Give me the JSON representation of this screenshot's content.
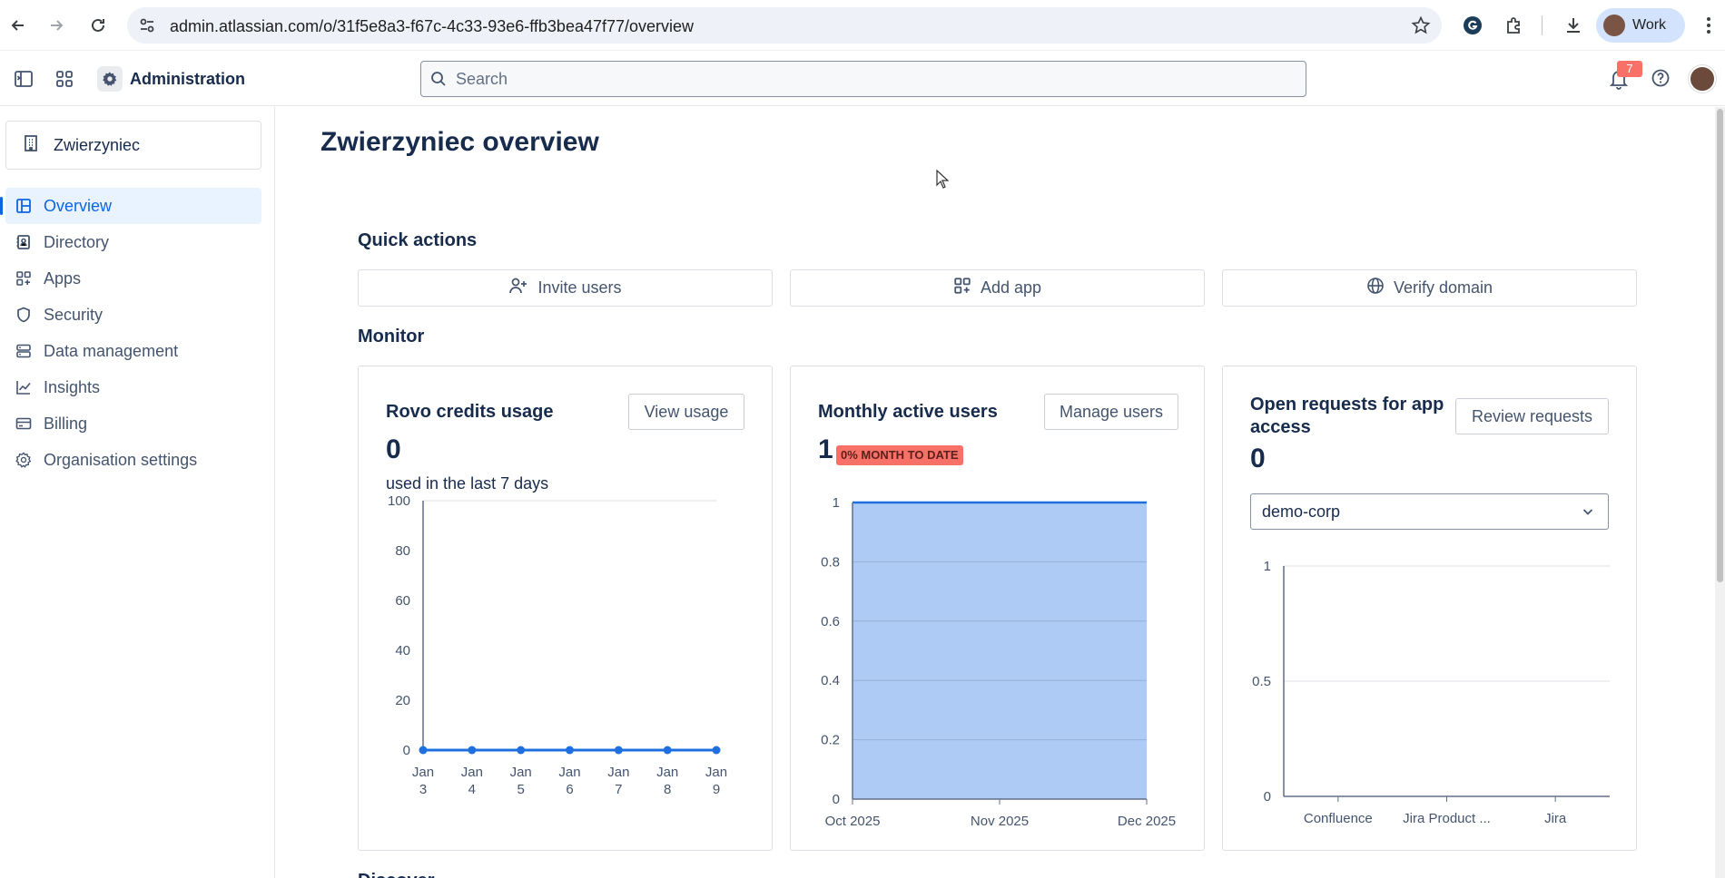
{
  "browser": {
    "url": "admin.atlassian.com/o/31f5e8a3-f67c-4c33-93e6-ffb3bea47f77/overview",
    "profile_label": "Work"
  },
  "header": {
    "title": "Administration",
    "search_placeholder": "Search",
    "notifications_count": "7"
  },
  "sidebar": {
    "org_name": "Zwierzyniec",
    "items": [
      {
        "label": "Overview",
        "icon": "overview-icon",
        "active": true
      },
      {
        "label": "Directory",
        "icon": "directory-icon",
        "active": false
      },
      {
        "label": "Apps",
        "icon": "apps-icon",
        "active": false
      },
      {
        "label": "Security",
        "icon": "shield-icon",
        "active": false
      },
      {
        "label": "Data management",
        "icon": "database-icon",
        "active": false
      },
      {
        "label": "Insights",
        "icon": "chart-line-icon",
        "active": false
      },
      {
        "label": "Billing",
        "icon": "credit-card-icon",
        "active": false
      },
      {
        "label": "Organisation settings",
        "icon": "gear-icon",
        "active": false
      }
    ]
  },
  "main": {
    "page_title": "Zwierzyniec overview",
    "quick_actions_title": "Quick actions",
    "quick_actions": [
      {
        "label": "Invite users",
        "icon": "add-user-icon"
      },
      {
        "label": "Add app",
        "icon": "add-app-icon"
      },
      {
        "label": "Verify domain",
        "icon": "globe-icon"
      }
    ],
    "monitor_title": "Monitor",
    "discover_title": "Discover",
    "cards": {
      "rovo": {
        "title": "Rovo credits usage",
        "button": "View usage",
        "value": "0",
        "subtitle": "used in the last 7 days"
      },
      "mau": {
        "title": "Monthly active users",
        "button": "Manage users",
        "value": "1",
        "lozenge": "0% MONTH TO DATE"
      },
      "requests": {
        "title": "Open requests for app access",
        "button": "Review requests",
        "value": "0",
        "select_value": "demo-corp"
      }
    }
  },
  "chart_data": [
    {
      "type": "line",
      "categories": [
        "Jan 3",
        "Jan 4",
        "Jan 5",
        "Jan 6",
        "Jan 7",
        "Jan 8",
        "Jan 9"
      ],
      "tick_top": [
        "Jan",
        "Jan",
        "Jan",
        "Jan",
        "Jan",
        "Jan",
        "Jan"
      ],
      "tick_bottom": [
        "3",
        "4",
        "5",
        "6",
        "7",
        "8",
        "9"
      ],
      "values": [
        0,
        0,
        0,
        0,
        0,
        0,
        0
      ],
      "yticks": [
        "100",
        "80",
        "60",
        "40",
        "20",
        "0"
      ],
      "ylim": [
        0,
        100
      ],
      "color": "#1f6fe0"
    },
    {
      "type": "area",
      "x": [
        "Oct 2025",
        "Nov 2025",
        "Dec 2025"
      ],
      "values": [
        1,
        1,
        1
      ],
      "yticks": [
        "1",
        "0.8",
        "0.6",
        "0.4",
        "0.2",
        "0"
      ],
      "ylim": [
        0,
        1
      ],
      "fill": "#adcbf4",
      "color": "#1f6fe0"
    },
    {
      "type": "bar",
      "categories": [
        "Confluence",
        "Jira Product ...",
        "Jira"
      ],
      "values": [
        0,
        0,
        0
      ],
      "yticks": [
        "1",
        "0.5",
        "0"
      ],
      "ylim": [
        0,
        1
      ]
    }
  ]
}
